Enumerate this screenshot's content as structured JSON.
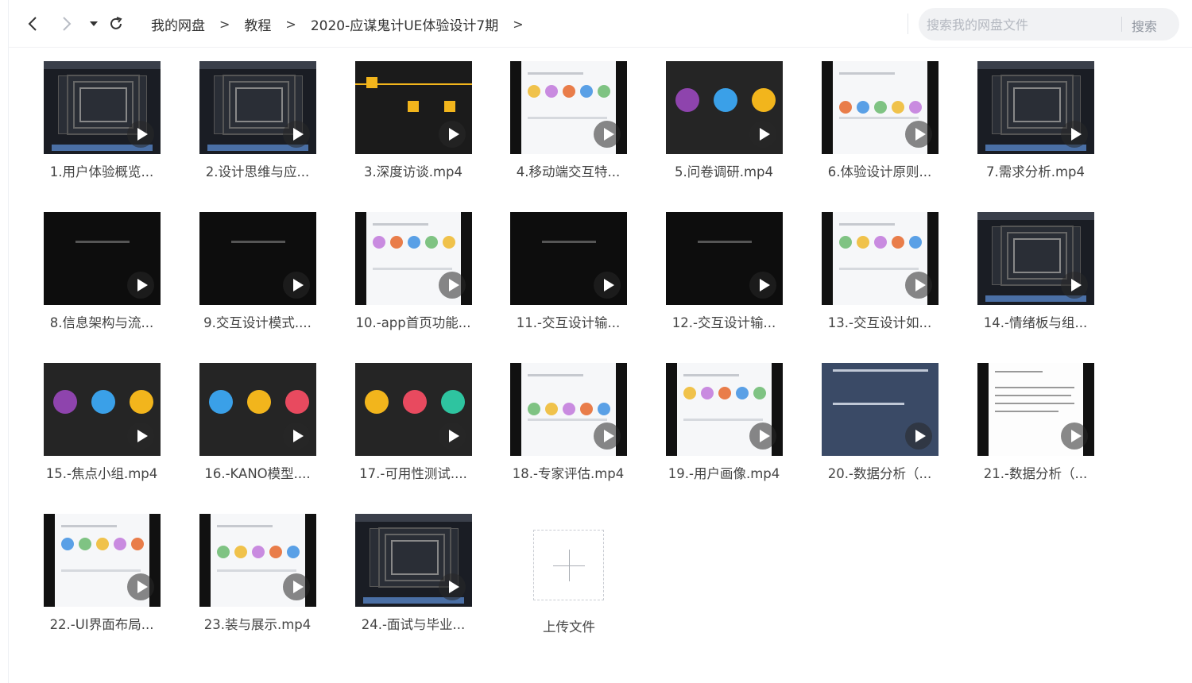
{
  "nav": {
    "back_icon": "chevron-left-icon",
    "forward_icon": "chevron-right-icon",
    "history_icon": "caret-down-icon",
    "refresh_icon": "refresh-icon"
  },
  "breadcrumb": {
    "items": [
      "我的网盘",
      "教程",
      "2020-应谋鬼计UE体验设计7期"
    ],
    "separator": ">"
  },
  "search": {
    "placeholder": "搜索我的网盘文件",
    "button_label": "搜索"
  },
  "files": [
    {
      "name": "1.用户体验概览...",
      "thumb": "ui"
    },
    {
      "name": "2.设计思维与应...",
      "thumb": "ui"
    },
    {
      "name": "3.深度访谈.mp4",
      "thumb": "yellow"
    },
    {
      "name": "4.移动端交互特...",
      "thumb": "white"
    },
    {
      "name": "5.问卷调研.mp4",
      "thumb": "circles"
    },
    {
      "name": "6.体验设计原则...",
      "thumb": "white"
    },
    {
      "name": "7.需求分析.mp4",
      "thumb": "ui"
    },
    {
      "name": "8.信息架构与流...",
      "thumb": "dark"
    },
    {
      "name": "9.交互设计模式....",
      "thumb": "dark"
    },
    {
      "name": "10.-app首页功能...",
      "thumb": "white"
    },
    {
      "name": "11.-交互设计输...",
      "thumb": "dark"
    },
    {
      "name": "12.-交互设计输...",
      "thumb": "dark"
    },
    {
      "name": "13.-交互设计如...",
      "thumb": "white"
    },
    {
      "name": "14.-情绪板与组...",
      "thumb": "ui"
    },
    {
      "name": "15.-焦点小组.mp4",
      "thumb": "circles"
    },
    {
      "name": "16.-KANO模型....",
      "thumb": "circles"
    },
    {
      "name": "17.-可用性测试....",
      "thumb": "circles"
    },
    {
      "name": "18.-专家评估.mp4",
      "thumb": "white"
    },
    {
      "name": "19.-用户画像.mp4",
      "thumb": "white"
    },
    {
      "name": "20.-数据分析（...",
      "thumb": "blue"
    },
    {
      "name": "21.-数据分析（...",
      "thumb": "doc"
    },
    {
      "name": "22.-UI界面布局...",
      "thumb": "white"
    },
    {
      "name": "23.装与展示.mp4",
      "thumb": "white"
    },
    {
      "name": "24.-面试与毕业...",
      "thumb": "ui"
    }
  ],
  "upload": {
    "label": "上传文件",
    "icon": "plus-icon"
  },
  "colors": {
    "play_overlay": "#282828",
    "accent_yellow": "#f2b51c",
    "search_bg": "#f1f2f4"
  }
}
